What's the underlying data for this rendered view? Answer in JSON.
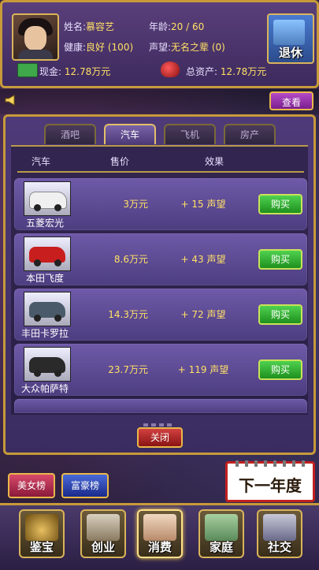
{
  "player": {
    "name_label": "姓名:",
    "name": "慕容艺",
    "age_label": "年龄:",
    "age": "20 / 60",
    "health_label": "健康:",
    "health": "良好 (100)",
    "fame_label": "声望:",
    "fame": "无名之辈 (0)",
    "cash_label": "现金:",
    "cash": "12.78万元",
    "assets_label": "总资产:",
    "assets": "12.78万元"
  },
  "retire_label": "退休",
  "view_label": "查看",
  "tabs": [
    {
      "label": "酒吧",
      "active": false
    },
    {
      "label": "汽车",
      "active": true
    },
    {
      "label": "飞机",
      "active": false
    },
    {
      "label": "房产",
      "active": false
    }
  ],
  "columns": {
    "item": "汽车",
    "price": "售价",
    "effect": "效果"
  },
  "cars": [
    {
      "name": "五菱宏光",
      "price": "3万元",
      "effect": "+ 15 声望",
      "buy": "购买",
      "color": "#e8e8e8"
    },
    {
      "name": "本田飞度",
      "price": "8.6万元",
      "effect": "+ 43 声望",
      "buy": "购买",
      "color": "#c81e1e"
    },
    {
      "name": "丰田卡罗拉",
      "price": "14.3万元",
      "effect": "+ 72 声望",
      "buy": "购买",
      "color": "#4a5a6a"
    },
    {
      "name": "大众帕萨特",
      "price": "23.7万元",
      "effect": "+ 119 声望",
      "buy": "购买",
      "color": "#2a2a2a"
    }
  ],
  "close_label": "关闭",
  "rank_beauty": "美女榜",
  "rank_rich": "富豪榜",
  "next_year": "下一年度",
  "nav": [
    {
      "label": "鉴宝",
      "icon": "vase-icon"
    },
    {
      "label": "创业",
      "icon": "business-icon"
    },
    {
      "label": "消费",
      "icon": "shopping-icon"
    },
    {
      "label": "家庭",
      "icon": "family-icon"
    },
    {
      "label": "社交",
      "icon": "handshake-icon"
    }
  ]
}
